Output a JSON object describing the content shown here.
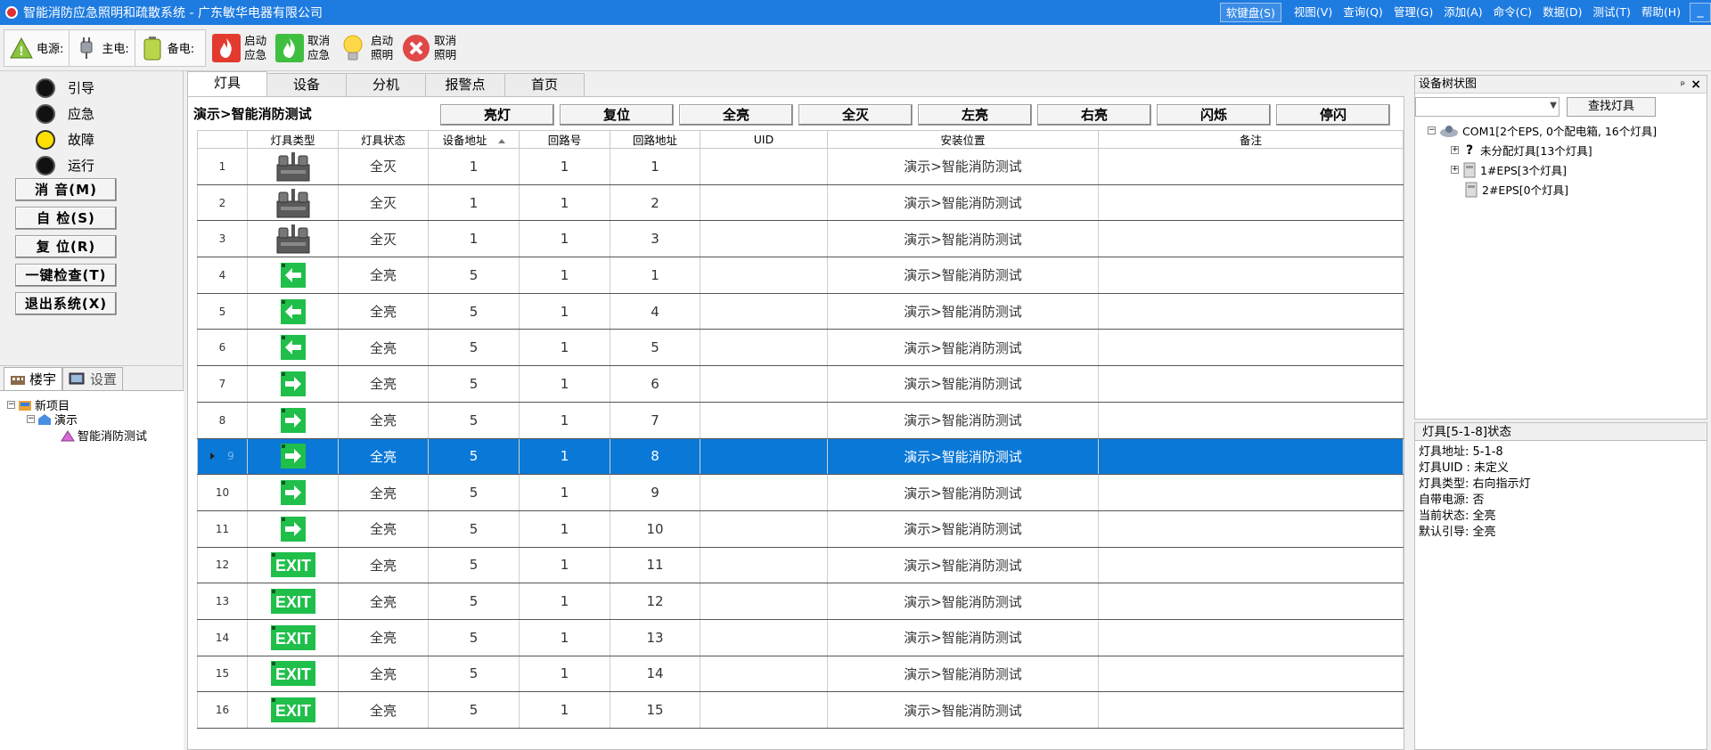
{
  "window": {
    "title": "智能消防应急照明和疏散系统 - 广东敏华电器有限公司"
  },
  "menu": [
    {
      "label": "软键盘(S)"
    },
    {
      "label": "视图(V)"
    },
    {
      "label": "查询(Q)"
    },
    {
      "label": "管理(G)"
    },
    {
      "label": "添加(A)"
    },
    {
      "label": "命令(C)"
    },
    {
      "label": "数据(D)"
    },
    {
      "label": "测试(T)"
    },
    {
      "label": "帮助(H)"
    }
  ],
  "minimize": "_",
  "power": {
    "mains": "电源:",
    "main": "主电:",
    "backup": "备电:"
  },
  "toolbar": [
    {
      "label": "启动应急",
      "icon": "fire-start-icon"
    },
    {
      "label": "取消应急",
      "icon": "fire-cancel-icon"
    },
    {
      "label": "启动照明",
      "icon": "bulb-icon"
    },
    {
      "label": "取消照明",
      "icon": "cancel-icon"
    }
  ],
  "leds": [
    {
      "label": "引导",
      "on": false
    },
    {
      "label": "应急",
      "on": false
    },
    {
      "label": "故障",
      "on": true
    },
    {
      "label": "运行",
      "on": false
    }
  ],
  "left_buttons": [
    "消 音(M)",
    "自 检(S)",
    "复 位(R)",
    "一键检查(T)",
    "退出系统(X)"
  ],
  "tree_tabs": [
    "楼宇",
    "设置"
  ],
  "tree": {
    "root": "新项目",
    "child": "演示",
    "leaf": "智能消防测试"
  },
  "main_tabs": [
    "灯具",
    "设备",
    "分机",
    "报警点",
    "首页"
  ],
  "content": {
    "path": "演示>智能消防测试",
    "actions": [
      "亮灯",
      "复位",
      "全亮",
      "全灭",
      "左亮",
      "右亮",
      "闪烁",
      "停闪"
    ]
  },
  "grid": {
    "headers": [
      "灯具类型",
      "灯具状态",
      "设备地址",
      "回路号",
      "回路地址",
      "UID",
      "安装位置",
      "备注"
    ],
    "selected_row": 9,
    "rows": [
      {
        "n": "1",
        "type": "eps",
        "status": "全灭",
        "device": "1",
        "loop": "1",
        "addr": "1",
        "uid": "",
        "location": "演示>智能消防测试",
        "note": ""
      },
      {
        "n": "2",
        "type": "eps",
        "status": "全灭",
        "device": "1",
        "loop": "1",
        "addr": "2",
        "uid": "",
        "location": "演示>智能消防测试",
        "note": ""
      },
      {
        "n": "3",
        "type": "eps",
        "status": "全灭",
        "device": "1",
        "loop": "1",
        "addr": "3",
        "uid": "",
        "location": "演示>智能消防测试",
        "note": ""
      },
      {
        "n": "4",
        "type": "left",
        "status": "全亮",
        "device": "5",
        "loop": "1",
        "addr": "1",
        "uid": "",
        "location": "演示>智能消防测试",
        "note": ""
      },
      {
        "n": "5",
        "type": "left",
        "status": "全亮",
        "device": "5",
        "loop": "1",
        "addr": "4",
        "uid": "",
        "location": "演示>智能消防测试",
        "note": ""
      },
      {
        "n": "6",
        "type": "left",
        "status": "全亮",
        "device": "5",
        "loop": "1",
        "addr": "5",
        "uid": "",
        "location": "演示>智能消防测试",
        "note": ""
      },
      {
        "n": "7",
        "type": "right",
        "status": "全亮",
        "device": "5",
        "loop": "1",
        "addr": "6",
        "uid": "",
        "location": "演示>智能消防测试",
        "note": ""
      },
      {
        "n": "8",
        "type": "right",
        "status": "全亮",
        "device": "5",
        "loop": "1",
        "addr": "7",
        "uid": "",
        "location": "演示>智能消防测试",
        "note": ""
      },
      {
        "n": "9",
        "type": "right",
        "status": "全亮",
        "device": "5",
        "loop": "1",
        "addr": "8",
        "uid": "",
        "location": "演示>智能消防测试",
        "note": ""
      },
      {
        "n": "10",
        "type": "right",
        "status": "全亮",
        "device": "5",
        "loop": "1",
        "addr": "9",
        "uid": "",
        "location": "演示>智能消防测试",
        "note": ""
      },
      {
        "n": "11",
        "type": "right",
        "status": "全亮",
        "device": "5",
        "loop": "1",
        "addr": "10",
        "uid": "",
        "location": "演示>智能消防测试",
        "note": ""
      },
      {
        "n": "12",
        "type": "exit",
        "status": "全亮",
        "device": "5",
        "loop": "1",
        "addr": "11",
        "uid": "",
        "location": "演示>智能消防测试",
        "note": ""
      },
      {
        "n": "13",
        "type": "exit",
        "status": "全亮",
        "device": "5",
        "loop": "1",
        "addr": "12",
        "uid": "",
        "location": "演示>智能消防测试",
        "note": ""
      },
      {
        "n": "14",
        "type": "exit",
        "status": "全亮",
        "device": "5",
        "loop": "1",
        "addr": "13",
        "uid": "",
        "location": "演示>智能消防测试",
        "note": ""
      },
      {
        "n": "15",
        "type": "exit",
        "status": "全亮",
        "device": "5",
        "loop": "1",
        "addr": "14",
        "uid": "",
        "location": "演示>智能消防测试",
        "note": ""
      },
      {
        "n": "16",
        "type": "exit",
        "status": "全亮",
        "device": "5",
        "loop": "1",
        "addr": "15",
        "uid": "",
        "location": "演示>智能消防测试",
        "note": ""
      }
    ],
    "exit_label": "EXIT"
  },
  "device_tree": {
    "title": "设备树状图",
    "pin": "ᵖ",
    "close": "×",
    "search_value": "",
    "find_button": "查找灯具",
    "nodes": [
      {
        "label": "COM1[2个EPS, 0个配电箱, 16个灯具]"
      },
      {
        "label": "未分配灯具[13个灯具]"
      },
      {
        "label": "1#EPS[3个灯具]"
      },
      {
        "label": "2#EPS[0个灯具]"
      }
    ]
  },
  "status": {
    "title": "灯具[5-1-8]状态",
    "lines": [
      "灯具地址: 5-1-8",
      "灯具UID : 未定义",
      "灯具类型: 右向指示灯",
      "自带电源: 否",
      "当前状态: 全亮",
      "默认引导: 全亮"
    ]
  },
  "colors": {
    "titlebar": "#1e7be0",
    "selected_row": "#0a78d7",
    "sign_green": "#1fbf4a",
    "led_on": "#ffe000"
  }
}
